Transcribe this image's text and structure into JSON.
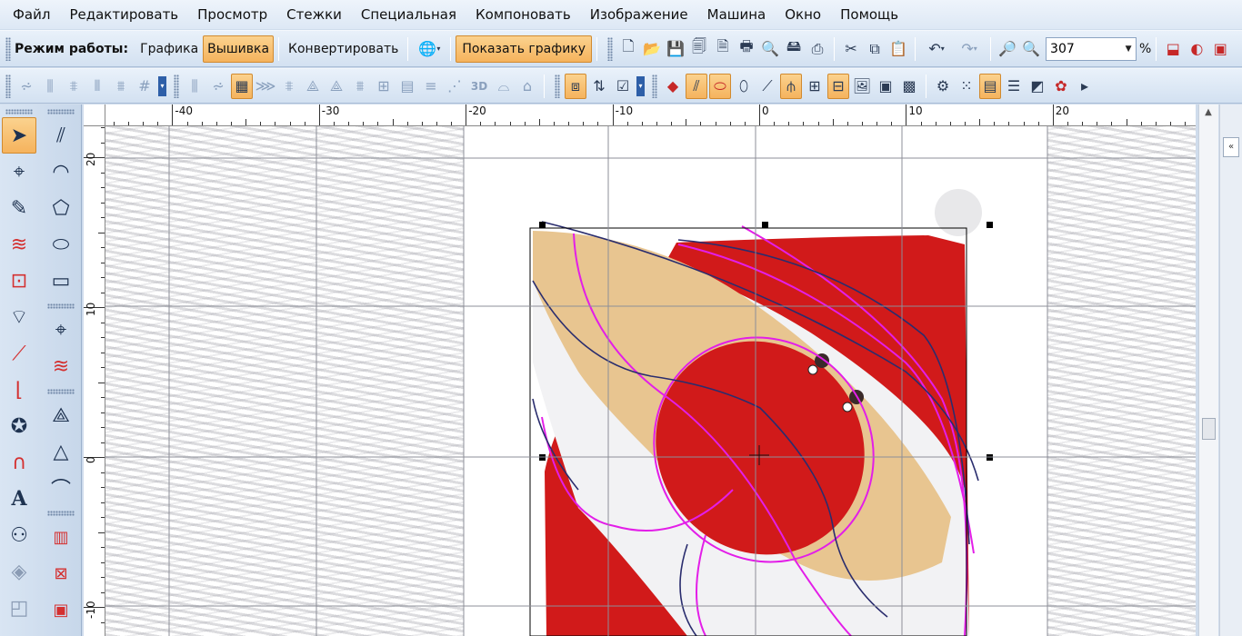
{
  "menu": [
    "Файл",
    "Редактировать",
    "Просмотр",
    "Стежки",
    "Специальная",
    "Компоновать",
    "Изображение",
    "Машина",
    "Окно",
    "Помощь"
  ],
  "toolbar1": {
    "mode_label": "Режим работы:",
    "mode_graphics": "Графика",
    "mode_embroidery": "Вышивка",
    "convert": "Конвертировать",
    "show_graphics": "Показать графику",
    "zoom_value": "307",
    "zoom_unit": "%"
  },
  "toolbar2": {
    "label_3d": "3D"
  },
  "rulers": {
    "top_labels": [
      "-40",
      "-30",
      "-20",
      "-10",
      "0",
      "10",
      "20"
    ],
    "left_labels": [
      "20",
      "10",
      "0",
      "-10"
    ]
  },
  "icons": {
    "left_col1": [
      "select-arrow-icon",
      "reshape-icon",
      "pen-icon",
      "zigzag-icon",
      "transform-icon",
      "nodes-icon",
      "measure-icon",
      "branch-icon",
      "star-icon",
      "horseshoe-icon",
      "text-tool-icon",
      "people-icon",
      "monogram-icon",
      "frame-icon",
      "flower-icon"
    ],
    "left_col2": [
      "parallel-lines-icon",
      "arc-icon",
      "shape-icon",
      "ellipse-icon",
      "rectangle-icon",
      "reshape-node-icon",
      "stitch-node-icon",
      "polygon-node-icon",
      "triangle-icon",
      "curve-icon",
      "fill-pattern-icon",
      "cross-stitch-icon",
      "satin-icon",
      "grid-stitch-icon"
    ]
  },
  "colors": {
    "accent": "#f5b35d",
    "toolbar": "#d3e1f1",
    "design_red": "#d11a1a",
    "design_tan": "#e8c590",
    "outline_magenta": "#e31ee8",
    "outline_navy": "#2a2d6e"
  }
}
